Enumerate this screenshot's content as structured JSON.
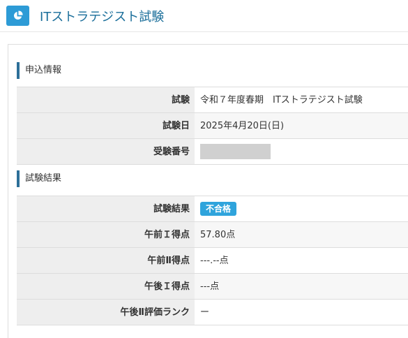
{
  "header": {
    "icon": "pie-chart-icon",
    "title": "ITストラテジスト試験"
  },
  "sections": {
    "application": {
      "title": "申込情報",
      "rows": [
        {
          "label": "試験",
          "value": "令和７年度春期　ITストラテジスト試験"
        },
        {
          "label": "試験日",
          "value": "2025年4月20日(日)"
        },
        {
          "label": "受験番号",
          "value": ""
        }
      ]
    },
    "results": {
      "title": "試験結果",
      "rows": [
        {
          "label": "試験結果",
          "value": "不合格"
        },
        {
          "label": "午前Ｉ得点",
          "value": "57.80点"
        },
        {
          "label": "午前Ⅱ得点",
          "value": "---.--点"
        },
        {
          "label": "午後Ｉ得点",
          "value": "---点"
        },
        {
          "label": "午後Ⅱ評価ランク",
          "value": "ー"
        }
      ]
    }
  },
  "colors": {
    "accent": "#2d9bd6",
    "title_text": "#1a6e9a",
    "badge": "#2fa4dc",
    "section_bar": "#2d6f98"
  }
}
